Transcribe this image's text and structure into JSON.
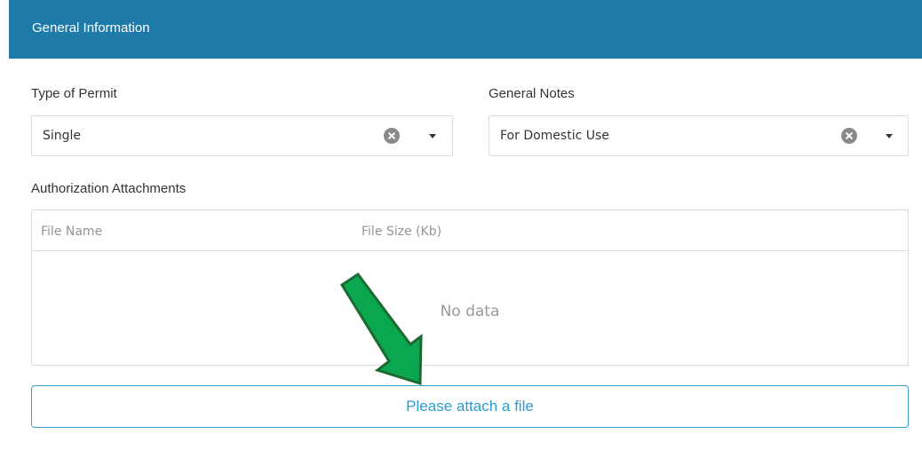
{
  "header": {
    "title": "General Information"
  },
  "permit": {
    "label": "Type of Permit",
    "value": "Single",
    "clear_icon": "clear-circle-x-icon",
    "dropdown_icon": "caret-down-icon"
  },
  "notes": {
    "label": "General Notes",
    "value": "For Domestic Use",
    "clear_icon": "clear-circle-x-icon",
    "dropdown_icon": "caret-down-icon"
  },
  "attachments": {
    "label": "Authorization Attachments",
    "columns": [
      "File Name",
      "File Size (Kb)"
    ],
    "rows": [],
    "empty_text": "No data"
  },
  "attach_button": {
    "label": "Please attach a file"
  },
  "annotation": {
    "icon": "green-arrow-icon",
    "color": "#0aa650"
  },
  "colors": {
    "header_bg": "#1e7aa8",
    "button_accent": "#2b9bd6"
  }
}
